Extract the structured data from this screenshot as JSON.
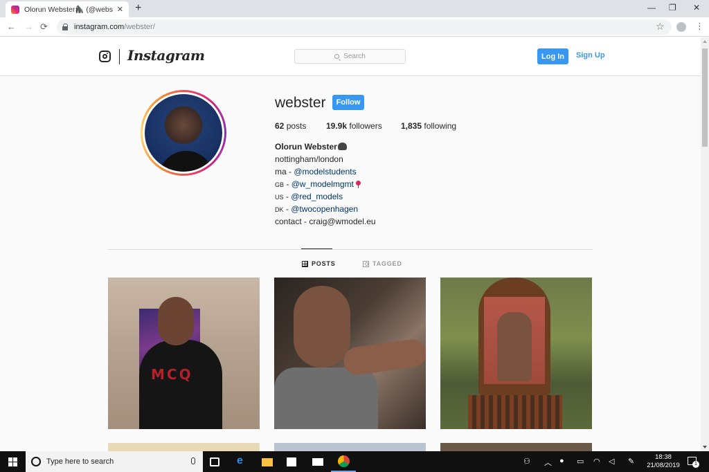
{
  "browser": {
    "tab_title": "Olorun Webster🦍 (@webster) •",
    "tab_close": "✕",
    "new_tab": "+",
    "url_host": "instagram.com",
    "url_path": "/webster/",
    "window_controls": {
      "minimize": "—",
      "restore": "❐",
      "close": "✕"
    },
    "nav": {
      "back": "←",
      "forward": "→",
      "reload": "⟳"
    },
    "star": "☆",
    "menu": "⋮"
  },
  "ig_header": {
    "wordmark": "Instagram",
    "search_placeholder": "Search",
    "login_label": "Log In",
    "signup_label": "Sign Up",
    "accent_color": "#3897f0"
  },
  "profile": {
    "username": "webster",
    "follow_label": "Follow",
    "posts_count": "62",
    "posts_label": "posts",
    "followers_count": "19.9k",
    "followers_label": "followers",
    "following_count": "1,835",
    "following_label": "following",
    "full_name": "Olorun Webster",
    "bio": {
      "line1": "nottingham/london",
      "line2_prefix": "ma - ",
      "line2_mention": "@modelstudents",
      "line3_flag": "GB",
      "line3_sep": " - ",
      "line3_mention": "@w_modelmgmt",
      "line4_flag": "US",
      "line4_sep": " - ",
      "line4_mention": "@red_models",
      "line5_flag": "DK",
      "line5_sep": " - ",
      "line5_mention": "@twocopenhagen",
      "line6": "contact - craig@wmodel.eu"
    }
  },
  "profile_tabs": {
    "posts_label": "POSTS",
    "tagged_label": "TAGGED"
  },
  "posts": [
    {
      "overlay_text": "MCQ"
    },
    {
      "overlay_text": ""
    },
    {
      "overlay_text": ""
    }
  ],
  "taskbar": {
    "search_placeholder": "Type here to search",
    "time": "18:38",
    "date": "21/08/2019",
    "notification_count": "1"
  }
}
